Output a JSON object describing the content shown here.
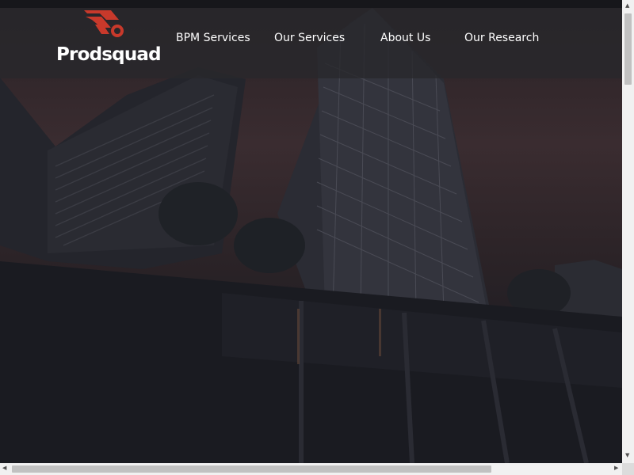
{
  "brand": {
    "name": "Prodsquad",
    "accent": "#c8392b"
  },
  "nav": {
    "items": [
      {
        "label": "BPM Services"
      },
      {
        "label": "Our Services"
      },
      {
        "label": "About Us"
      },
      {
        "label": "Our Research"
      }
    ]
  },
  "hero": {
    "image": "city-skyscrapers-at-dusk"
  },
  "scrollbars": {
    "vertical": true,
    "horizontal": true
  }
}
